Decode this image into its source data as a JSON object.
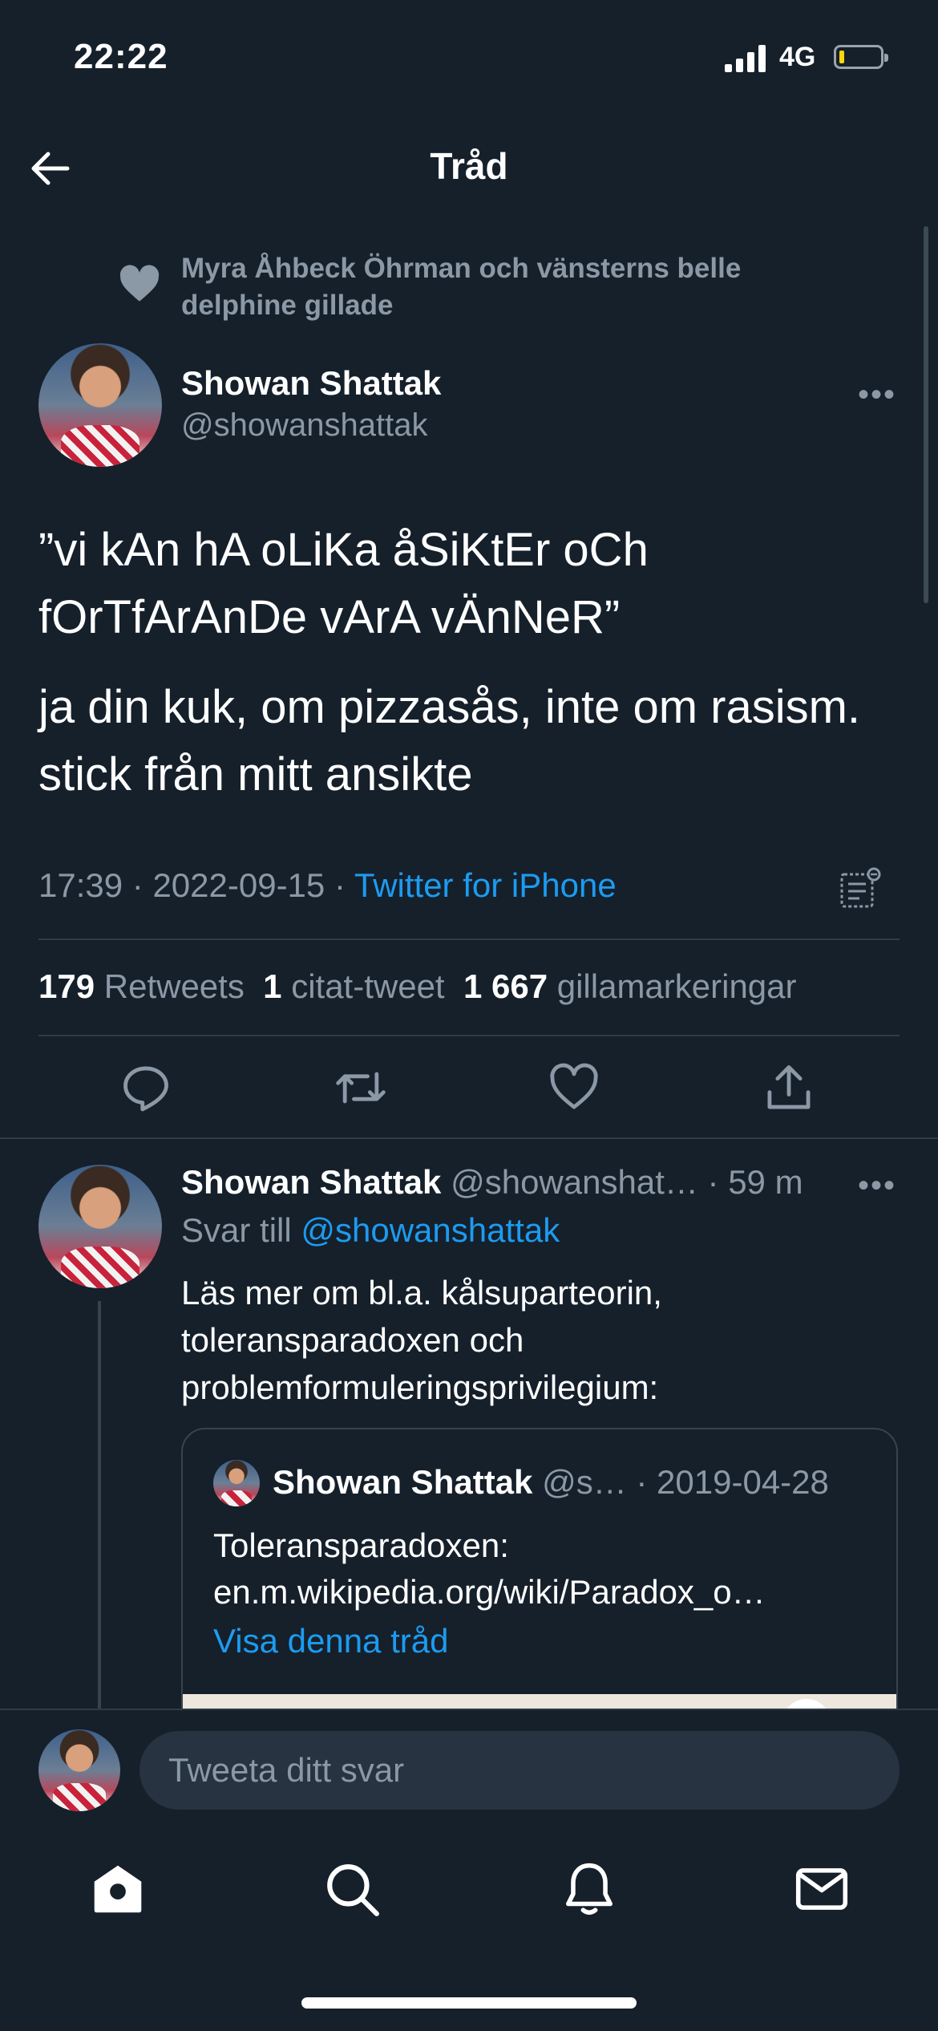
{
  "status_bar": {
    "time": "22:22",
    "network": "4G"
  },
  "header": {
    "title": "Tråd"
  },
  "social_context": {
    "text": "Myra Åhbeck Öhrman och vänsterns belle delphine gillade"
  },
  "tweet": {
    "author_name": "Showan Shattak",
    "author_handle": "@showanshattak",
    "text_line1": "”vi kAn hA oLiKa åSiKtEr oCh fOrTfArAnDe vArA vÄnNeR”",
    "text_line2": "ja din kuk, om pizzasås, inte om rasism. stick från mitt ansikte",
    "time": "17:39",
    "date": "2022-09-15",
    "source": "Twitter for iPhone",
    "sep": " · "
  },
  "stats": {
    "retweets_count": "179",
    "retweets_label": "Retweets",
    "quotes_count": "1",
    "quotes_label": "citat-tweet",
    "likes_count": "1 667",
    "likes_label": "gillamarkeringar"
  },
  "reply": {
    "author_name": "Showan Shattak",
    "author_handle": "@showanshat…",
    "time": "· 59 m",
    "reply_to_label": "Svar till",
    "reply_to_handle": "@showanshattak",
    "text": "Läs mer om bl.a. kålsuparteorin, toleransparadoxen och problemformuleringsprivilegium:"
  },
  "quote": {
    "author_name": "Showan Shattak",
    "author_handle": "@s…",
    "date": "· 2019-04-28",
    "text_line1": "Toleransparadoxen:",
    "text_line2": "en.m.wikipedia.org/wiki/Paradox_o…",
    "link": "Visa denna tråd"
  },
  "composer": {
    "placeholder": "Tweeta ditt svar"
  },
  "colors": {
    "background": "#15202b",
    "accent": "#1d9bf0",
    "muted": "#8b98a5",
    "divider": "#2f3b46"
  },
  "icons": [
    "back-arrow-icon",
    "heart-icon",
    "more-icon",
    "analytics-icon",
    "reply-icon",
    "retweet-icon",
    "like-icon",
    "share-icon",
    "home-icon",
    "search-icon",
    "notifications-icon",
    "messages-icon"
  ]
}
